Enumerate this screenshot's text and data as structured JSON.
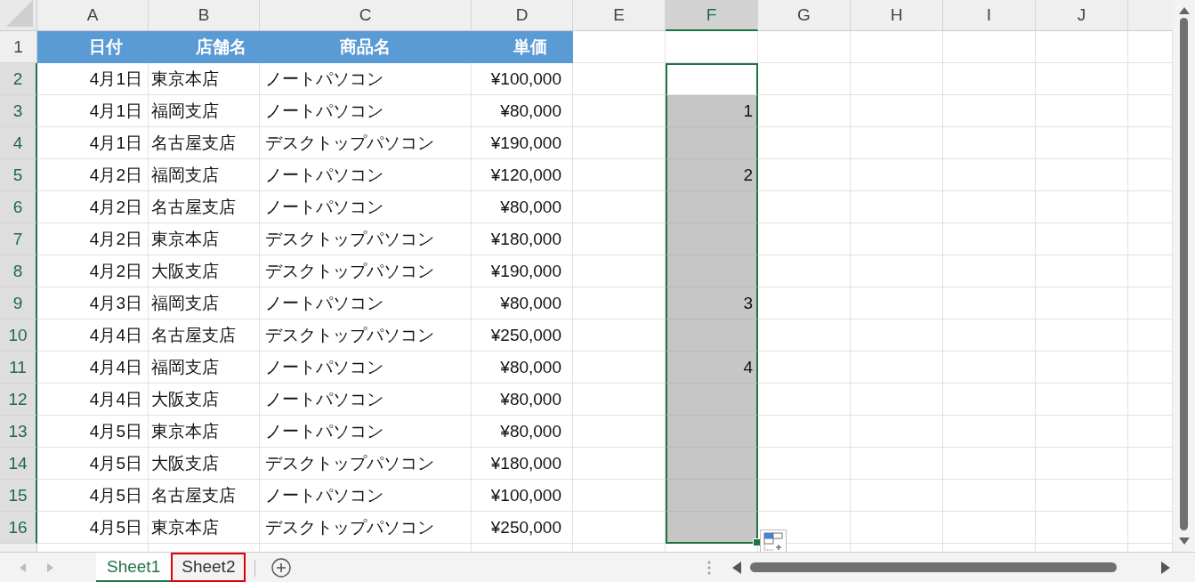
{
  "columns": [
    {
      "label": "A",
      "selected": false
    },
    {
      "label": "B",
      "selected": false
    },
    {
      "label": "C",
      "selected": false
    },
    {
      "label": "D",
      "selected": false
    },
    {
      "label": "E",
      "selected": false
    },
    {
      "label": "F",
      "selected": true
    },
    {
      "label": "G",
      "selected": false
    },
    {
      "label": "H",
      "selected": false
    },
    {
      "label": "I",
      "selected": false
    },
    {
      "label": "J",
      "selected": false
    }
  ],
  "header_row": {
    "label": "1",
    "selected": false,
    "cells": [
      "日付",
      "店舗名",
      "商品名",
      "単価"
    ]
  },
  "rows": [
    {
      "label": "2",
      "selected": true,
      "active": true,
      "date": "4月1日",
      "store": "東京本店",
      "product": "ノートパソコン",
      "price": "¥100,000"
    },
    {
      "label": "3",
      "selected": true,
      "active": false,
      "date": "4月1日",
      "store": "福岡支店",
      "product": "ノートパソコン",
      "price": "¥80,000",
      "f": "1"
    },
    {
      "label": "4",
      "selected": true,
      "active": false,
      "date": "4月1日",
      "store": "名古屋支店",
      "product": "デスクトップパソコン",
      "price": "¥190,000"
    },
    {
      "label": "5",
      "selected": true,
      "active": false,
      "date": "4月2日",
      "store": "福岡支店",
      "product": "ノートパソコン",
      "price": "¥120,000",
      "f": "2"
    },
    {
      "label": "6",
      "selected": true,
      "active": false,
      "date": "4月2日",
      "store": "名古屋支店",
      "product": "ノートパソコン",
      "price": "¥80,000"
    },
    {
      "label": "7",
      "selected": true,
      "active": false,
      "date": "4月2日",
      "store": "東京本店",
      "product": "デスクトップパソコン",
      "price": "¥180,000"
    },
    {
      "label": "8",
      "selected": true,
      "active": false,
      "date": "4月2日",
      "store": "大阪支店",
      "product": "デスクトップパソコン",
      "price": "¥190,000"
    },
    {
      "label": "9",
      "selected": true,
      "active": false,
      "date": "4月3日",
      "store": "福岡支店",
      "product": "ノートパソコン",
      "price": "¥80,000",
      "f": "3"
    },
    {
      "label": "10",
      "selected": true,
      "active": false,
      "date": "4月4日",
      "store": "名古屋支店",
      "product": "デスクトップパソコン",
      "price": "¥250,000"
    },
    {
      "label": "11",
      "selected": true,
      "active": false,
      "date": "4月4日",
      "store": "福岡支店",
      "product": "ノートパソコン",
      "price": "¥80,000",
      "f": "4"
    },
    {
      "label": "12",
      "selected": true,
      "active": false,
      "date": "4月4日",
      "store": "大阪支店",
      "product": "ノートパソコン",
      "price": "¥80,000"
    },
    {
      "label": "13",
      "selected": true,
      "active": false,
      "date": "4月5日",
      "store": "東京本店",
      "product": "ノートパソコン",
      "price": "¥80,000"
    },
    {
      "label": "14",
      "selected": true,
      "active": false,
      "date": "4月5日",
      "store": "大阪支店",
      "product": "デスクトップパソコン",
      "price": "¥180,000"
    },
    {
      "label": "15",
      "selected": true,
      "active": false,
      "date": "4月5日",
      "store": "名古屋支店",
      "product": "ノートパソコン",
      "price": "¥100,000"
    },
    {
      "label": "16",
      "selected": true,
      "active": false,
      "date": "4月5日",
      "store": "東京本店",
      "product": "デスクトップパソコン",
      "price": "¥250,000"
    }
  ],
  "sheet_tabs": [
    {
      "label": "Sheet1",
      "selected": true,
      "highlighted": false
    },
    {
      "label": "Sheet2",
      "selected": false,
      "highlighted": true
    }
  ]
}
